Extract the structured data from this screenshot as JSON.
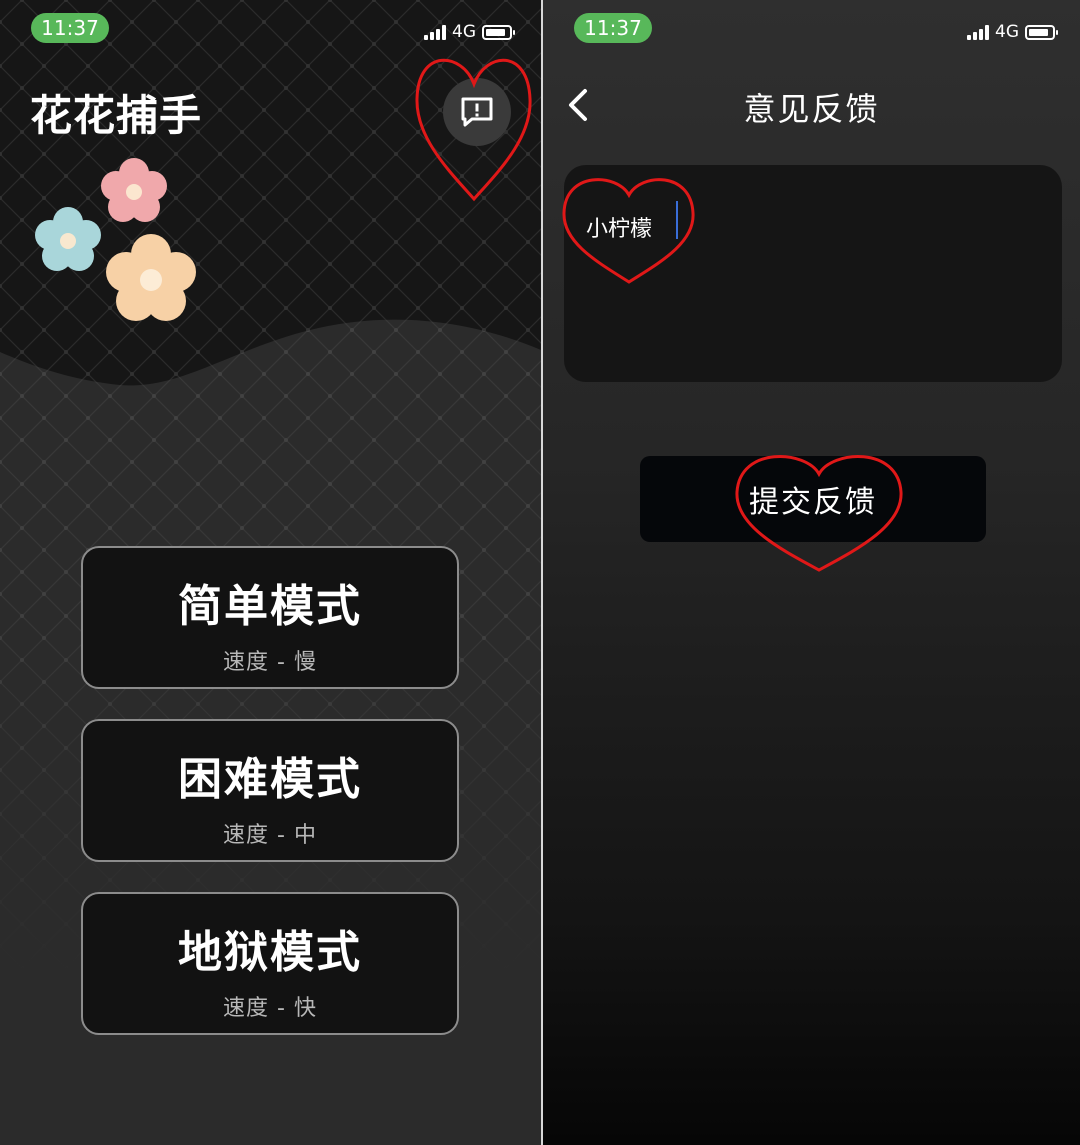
{
  "left": {
    "status": {
      "time": "11:37",
      "network": "4G"
    },
    "app_title": "花花捕手",
    "modes": [
      {
        "title": "简单模式",
        "subtitle": "速度 - 慢"
      },
      {
        "title": "困难模式",
        "subtitle": "速度 - 中"
      },
      {
        "title": "地狱模式",
        "subtitle": "速度 - 快"
      }
    ],
    "icons": {
      "feedback": "feedback-bubble-icon"
    }
  },
  "right": {
    "status": {
      "time": "11:37",
      "network": "4G"
    },
    "page_title": "意见反馈",
    "feedback_input_value": "小柠檬",
    "submit_label": "提交反馈",
    "icons": {
      "back": "chevron-left-icon"
    }
  },
  "colors": {
    "time_pill": "#58b85a",
    "annotation": "#e01818",
    "flower_pink": "#f0a8ab",
    "flower_blue": "#a9d6da",
    "flower_peach": "#f7d1a6"
  }
}
